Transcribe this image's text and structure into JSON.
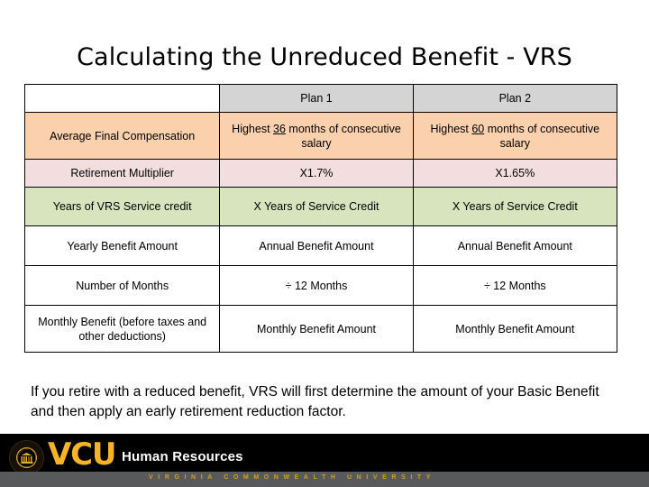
{
  "slide": {
    "title": "Calculating the Unreduced Benefit - VRS",
    "note": "If you retire with a reduced benefit, VRS will first determine the amount of your Basic Benefit and then apply an early retirement reduction factor."
  },
  "table": {
    "headers": {
      "label_col": "",
      "plan1": "Plan 1",
      "plan2": "Plan 2"
    },
    "rows": [
      {
        "label": "Average Final Compensation",
        "plan1_pre": "Highest ",
        "plan1_underline": "36",
        "plan1_post": " months of consecutive salary",
        "plan2_pre": "Highest ",
        "plan2_underline": "60",
        "plan2_post": " months of consecutive salary"
      },
      {
        "label": "Retirement Multiplier",
        "plan1": "X1.7%",
        "plan2": "X1.65%"
      },
      {
        "label": "Years of VRS Service credit",
        "plan1": "X Years of Service Credit",
        "plan2": "X Years of Service Credit"
      },
      {
        "label": "Yearly Benefit Amount",
        "plan1": "Annual Benefit Amount",
        "plan2": "Annual Benefit Amount"
      },
      {
        "label": "Number of Months",
        "plan1": "÷ 12 Months",
        "plan2": "÷ 12 Months"
      },
      {
        "label": "Monthly Benefit (before taxes and other deductions)",
        "plan1": "Monthly Benefit Amount",
        "plan2": "Monthly Benefit Amount"
      }
    ],
    "row_colors": {
      "header": "#d4d4d4",
      "average_final_compensation": "#fbd0ac",
      "retirement_multiplier": "#f2dedf",
      "years_of_service": "#d8e4bd",
      "plain": "#ffffff"
    }
  },
  "footer": {
    "brand": "VCU",
    "department": "Human Resources",
    "strip_text": "VIRGINIA COMMONWEALTH UNIVERSITY",
    "colors": {
      "bar": "#000000",
      "strip": "#58595b",
      "gold": "#f5b325",
      "strip_gold": "#d4a017"
    }
  }
}
